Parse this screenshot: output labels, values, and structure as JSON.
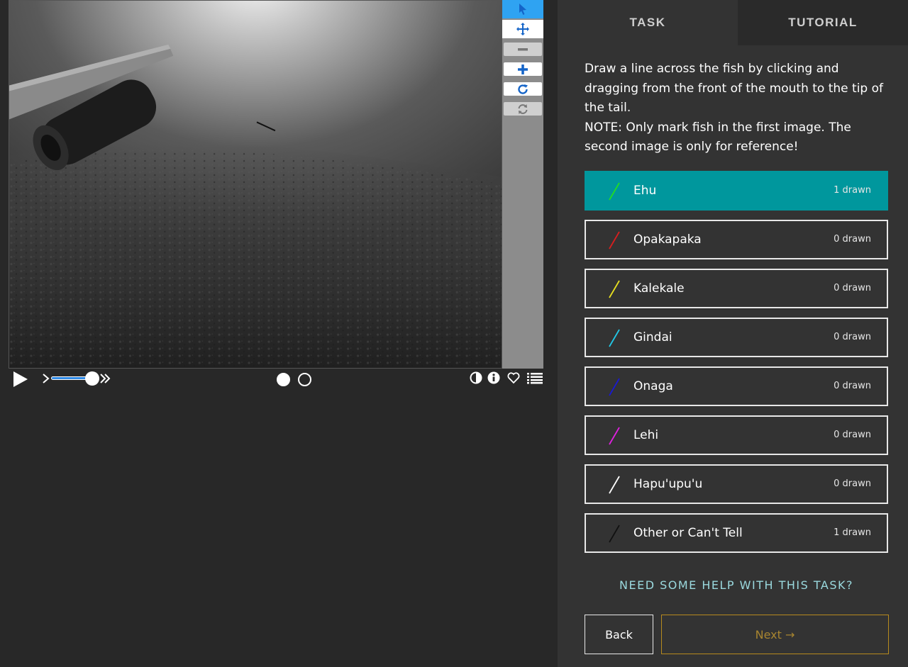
{
  "tabs": [
    {
      "label": "TASK"
    },
    {
      "label": "TUTORIAL"
    }
  ],
  "instructions": {
    "line1": "Draw a line across the fish by clicking and dragging from the front of the mouth to the tip of the tail.",
    "line2": "NOTE: Only mark fish in the first image. The second image is only for reference!"
  },
  "choices": [
    {
      "label": "Ehu",
      "count": "1 drawn",
      "color": "#22dd22",
      "selected": true
    },
    {
      "label": "Opakapaka",
      "count": "0 drawn",
      "color": "#d81e1e",
      "selected": false
    },
    {
      "label": "Kalekale",
      "count": "0 drawn",
      "color": "#e8e020",
      "selected": false
    },
    {
      "label": "Gindai",
      "count": "0 drawn",
      "color": "#22c8e8",
      "selected": false
    },
    {
      "label": "Onaga",
      "count": "0 drawn",
      "color": "#1a1ad0",
      "selected": false
    },
    {
      "label": "Lehi",
      "count": "0 drawn",
      "color": "#e020e0",
      "selected": false
    },
    {
      "label": "Hapu'upu'u",
      "count": "0 drawn",
      "color": "#ffffff",
      "selected": false
    },
    {
      "label": "Other or Can't Tell",
      "count": "1 drawn",
      "color": "#111111",
      "selected": false
    }
  ],
  "help": {
    "label": "NEED SOME HELP WITH THIS TASK?"
  },
  "nav": {
    "back_label": "Back",
    "next_label": "Next →"
  },
  "toolbar": {
    "tools": [
      "pointer-icon",
      "pan-icon",
      "zoom-out-icon",
      "zoom-in-icon",
      "rotate-icon",
      "reset-icon"
    ]
  },
  "playback": {
    "frames": 2,
    "current_frame": 1,
    "speed_fraction": 0.85
  },
  "colors": {
    "accent": "#00979d",
    "toolbar_active": "#2fa3f2",
    "next_border": "#b78a1e"
  }
}
